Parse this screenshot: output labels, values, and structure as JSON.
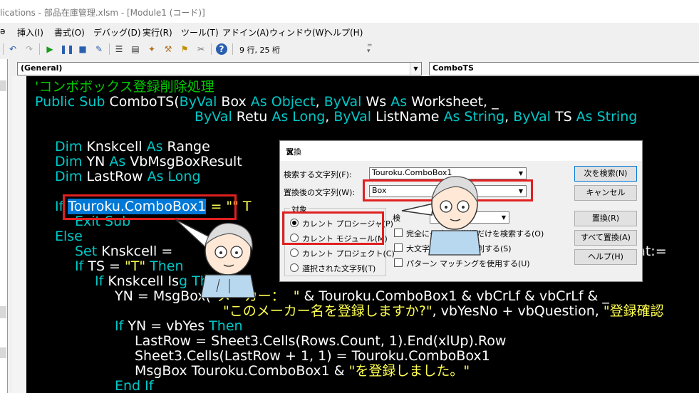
{
  "window": {
    "title": "lications - 部品在庫管理.xlsm - [Module1 (コード)]"
  },
  "menu": {
    "items": [
      "挿入(I)",
      "書式(O)",
      "デバッグ(D)",
      "実行(R)",
      "ツール(T)",
      "アドイン(A)",
      "ウィンドウ(W)",
      "ヘルプ(H)"
    ]
  },
  "toolbar": {
    "cursor_position": "9 行, 25 桁"
  },
  "editor": {
    "object_combo": "(General)",
    "procedure_combo": "ComboTS",
    "lines": [
      [
        [
          "'コンボボックス登録削除処理",
          "cm"
        ]
      ],
      [
        [
          "Public Sub ",
          "kw"
        ],
        [
          "ComboTS(",
          ""
        ],
        [
          "ByVal",
          "kw"
        ],
        [
          " Box ",
          ""
        ],
        [
          "As Object",
          "kw"
        ],
        [
          ", ",
          ""
        ],
        [
          "ByVal",
          "kw"
        ],
        [
          " Ws ",
          ""
        ],
        [
          "As",
          "kw"
        ],
        [
          " Worksheet, _",
          ""
        ]
      ],
      [
        [
          "ByVal",
          "kw"
        ],
        [
          " Retu ",
          ""
        ],
        [
          "As Long",
          "kw"
        ],
        [
          ", ",
          ""
        ],
        [
          "ByVal",
          "kw"
        ],
        [
          " ListName ",
          ""
        ],
        [
          "As String",
          "kw"
        ],
        [
          ", ",
          ""
        ],
        [
          "ByVal",
          "kw"
        ],
        [
          " TS ",
          ""
        ],
        [
          "As String",
          "kw"
        ]
      ],
      [],
      [
        [
          "Dim",
          "kw"
        ],
        [
          " Knskcell ",
          ""
        ],
        [
          "As",
          "kw"
        ],
        [
          " Range",
          ""
        ]
      ],
      [
        [
          "Dim",
          "kw"
        ],
        [
          " YN ",
          ""
        ],
        [
          "As",
          "kw"
        ],
        [
          " VbMsgBoxResult",
          ""
        ]
      ],
      [
        [
          "Dim",
          "kw"
        ],
        [
          " LastRow ",
          ""
        ],
        [
          "As Long",
          "kw"
        ]
      ],
      [],
      [
        [
          "If ",
          "kw"
        ],
        [
          "Touroku.ComboBox1",
          "sel"
        ],
        [
          " = \"\" T",
          "st"
        ]
      ],
      [
        [
          "Exit Sub",
          "kw"
        ]
      ],
      [
        [
          "Else",
          "kw"
        ]
      ],
      [
        [
          "Set",
          "kw"
        ],
        [
          " Knskcell = ",
          ""
        ],
        [
          "lookat:=",
          ""
        ]
      ],
      [
        [
          "If",
          "kw"
        ],
        [
          " TS = ",
          ""
        ],
        [
          "\"T\"",
          "st"
        ],
        [
          " Then",
          "kw"
        ]
      ],
      [
        [
          "If",
          "kw"
        ],
        [
          " Knskcell Is",
          ""
        ],
        [
          "g Then",
          "kw"
        ]
      ],
      [
        [
          "YN = MsgBox(",
          ""
        ],
        [
          "\"メーカー：  \"",
          "st"
        ],
        [
          " & Touroku.ComboBox1 & vbCrLf & vbCrLf & _",
          ""
        ]
      ],
      [
        [
          "\"このメーカー名を登録しますか?\"",
          "st"
        ],
        [
          ", vbYesNo + vbQuestion, ",
          ""
        ],
        [
          "\"登録確認",
          "st"
        ]
      ],
      [
        [
          "If",
          "kw"
        ],
        [
          " YN = vbYes ",
          ""
        ],
        [
          "Then",
          "kw"
        ]
      ],
      [
        [
          "LastRow = Sheet3.Cells(Rows.Count, 1).End(xlUp).Row",
          ""
        ]
      ],
      [
        [
          "Sheet3.Cells(LastRow + 1, 1) = Touroku.ComboBox1",
          ""
        ]
      ],
      [
        [
          "MsgBox Touroku.ComboBox1 & ",
          ""
        ],
        [
          "\"を登録しました。\"",
          "st"
        ]
      ],
      [
        [
          "End If",
          "kw"
        ]
      ]
    ]
  },
  "dialog": {
    "title": "置換",
    "find_label": "検索する文字列(F):",
    "find_value": "Touroku.ComboBox1",
    "replace_label": "置換後の文字列(W):",
    "replace_value": "Box",
    "scope_label": "対象",
    "scope_options": [
      "カレント プロシージャ(P)",
      "カレント モジュール(M)",
      "カレント プロジェクト(C)",
      "選択された文字列(T)"
    ],
    "direction_label": "検",
    "options": [
      "完全に一致する単語だけを検索する(O)",
      "大文字と小文字を区別する(S)",
      "パターン マッチングを使用する(U)"
    ],
    "buttons": {
      "find_next": "次を検索(N)",
      "cancel": "キャンセル",
      "replace": "置換(R)",
      "replace_all": "すべて置換(A)",
      "help": "ヘルプ(H)"
    }
  }
}
